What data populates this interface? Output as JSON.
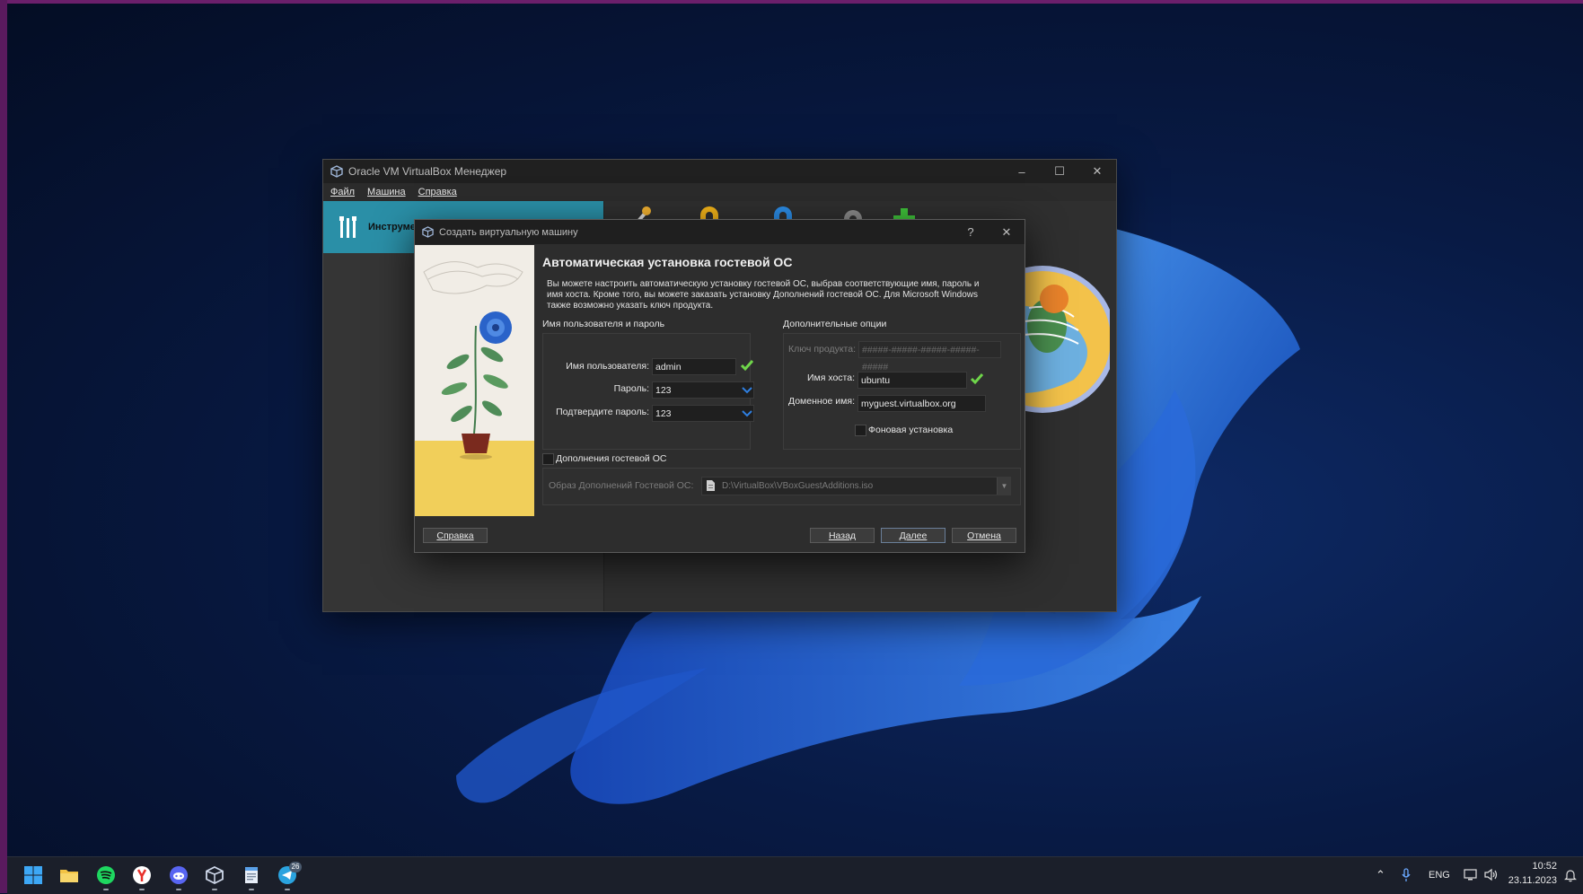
{
  "manager": {
    "title": "Oracle VM VirtualBox Менеджер",
    "menu": [
      "Файл",
      "Машина",
      "Справка"
    ],
    "tools_label": "Инструменты"
  },
  "dialog": {
    "title": "Создать виртуальную машину",
    "help_glyph": "?",
    "heading": "Автоматическая установка гостевой ОС",
    "description": "Вы можете настроить автоматическую установку гостевой ОС, выбрав соответствующие имя, пароль и имя хоста. Кроме того, вы можете заказать установку Дополнений гостевой ОС. Для Microsoft Windows также возможно указать ключ продукта.",
    "user_group": {
      "title": "Имя пользователя и пароль",
      "username_label": "Имя пользователя:",
      "username_value": "admin",
      "password_label": "Пароль:",
      "password_value": "123",
      "confirm_label": "Подтвердите пароль:",
      "confirm_value": "123"
    },
    "options_group": {
      "title": "Дополнительные опции",
      "product_key_label": "Ключ продукта:",
      "product_key_placeholder": "#####-#####-#####-#####-#####",
      "hostname_label": "Имя хоста:",
      "hostname_value": "ubuntu",
      "domain_label": "Доменное имя:",
      "domain_value": "myguest.virtualbox.org",
      "headless_label": "Фоновая установка"
    },
    "guest_additions": {
      "checkbox_label": "Дополнения гостевой ОС",
      "iso_label": "Образ Дополнений Гостевой ОС:",
      "iso_value": "D:\\VirtualBox\\VBoxGuestAdditions.iso"
    },
    "buttons": {
      "help": "Справка",
      "back": "Назад",
      "next": "Далее",
      "cancel": "Отмена"
    }
  },
  "taskbar": {
    "apps": [
      "windows-start",
      "file-explorer",
      "spotify",
      "yandex-browser",
      "discord",
      "virtualbox",
      "notepad",
      "telegram"
    ],
    "telegram_badge": "26",
    "language": "ENG",
    "time": "10:52",
    "date": "23.11.2023"
  },
  "colors": {
    "accent": "#2a8fa7",
    "ok_green": "#6fd64a",
    "taskbar": "#1b1f2a"
  }
}
